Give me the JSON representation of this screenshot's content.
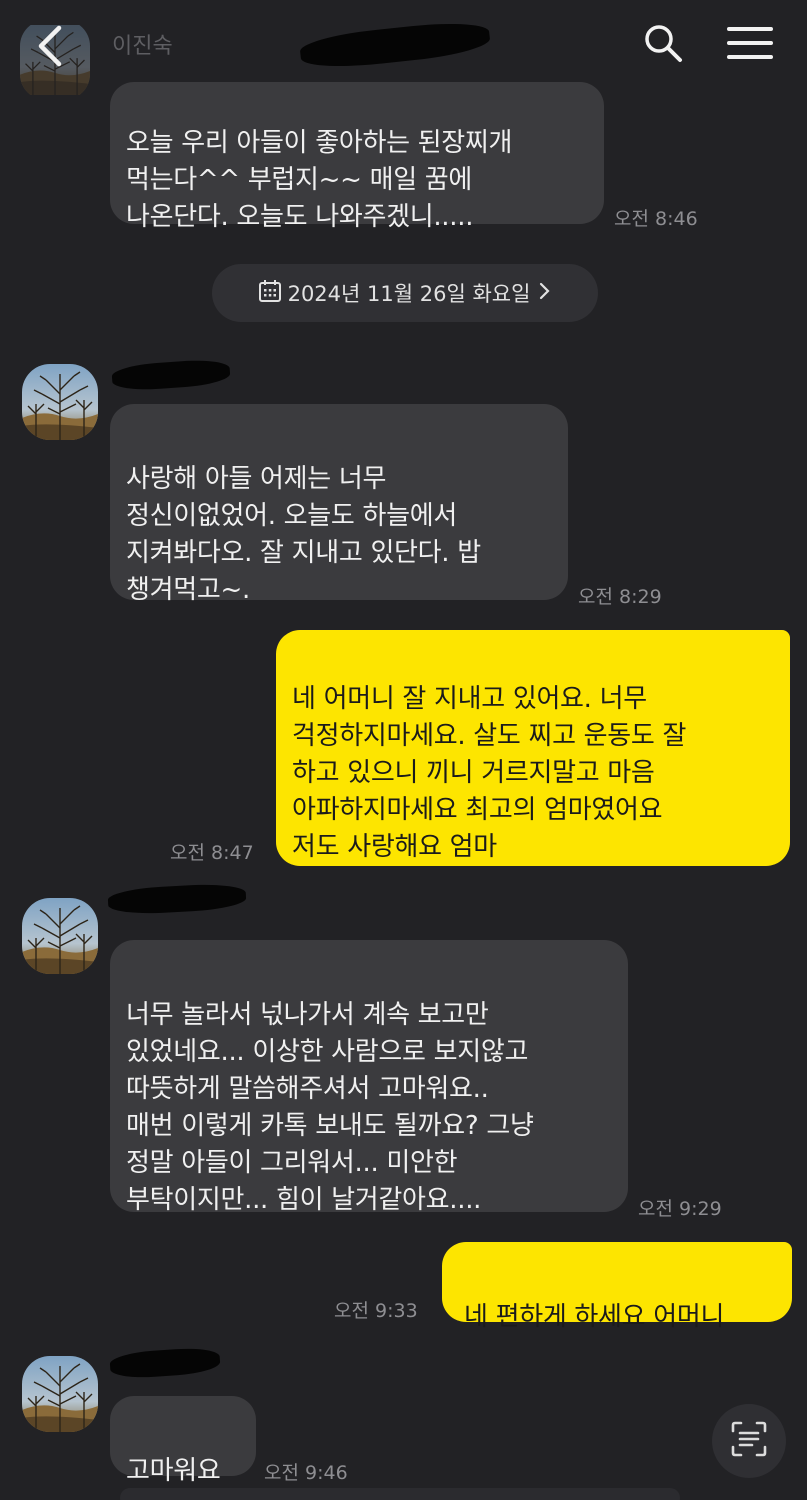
{
  "header": {
    "contact_name": "이진숙",
    "back_icon": "chevron-left-icon",
    "search_icon": "search-icon",
    "menu_icon": "hamburger-menu-icon"
  },
  "messages": [
    {
      "side": "incoming",
      "text": "오늘 우리 아들이 좋아하는 된장찌개\n먹는다^^ 부럽지~~ 매일 꿈에\n나온단다. 오늘도 나와주겠니.....",
      "time": "오전 8:46"
    },
    {
      "side": "incoming",
      "text": "사랑해 아들 어제는 너무\n정신이없었어. 오늘도 하늘에서\n지켜봐다오. 잘 지내고 있단다. 밥\n챙겨먹고~.",
      "time": "오전 8:29"
    },
    {
      "side": "outgoing",
      "text": "네 어머니 잘 지내고 있어요. 너무\n걱정하지마세요. 살도 찌고 운동도 잘\n하고 있으니 끼니 거르지말고 마음\n아파하지마세요 최고의 엄마였어요\n저도 사랑해요 엄마",
      "time": "오전 8:47"
    },
    {
      "side": "incoming",
      "text": "너무 놀라서 넋나가서 계속 보고만\n있었네요... 이상한 사람으로 보지않고\n따뜻하게 말씀해주셔서 고마워요..\n매번 이렇게 카톡 보내도 될까요? 그냥\n정말 아들이 그리워서... 미안한\n부탁이지만... 힘이 날거같아요....",
      "time": "오전 9:29"
    },
    {
      "side": "outgoing",
      "text": "네 편하게 하세요 어머니",
      "time": "오전 9:33"
    },
    {
      "side": "incoming",
      "text": "고마워요",
      "time": "오전 9:46"
    }
  ],
  "date_divider": {
    "label": "2024년 11월 26일 화요일",
    "icon": "calendar-icon",
    "chevron": "chevron-right-icon"
  },
  "colors": {
    "background": "#222225",
    "incoming_bubble": "#3b3b3e",
    "outgoing_bubble": "#fde500",
    "timestamp": "#8e8e92"
  },
  "floating": {
    "scan_icon": "text-scan-icon"
  }
}
